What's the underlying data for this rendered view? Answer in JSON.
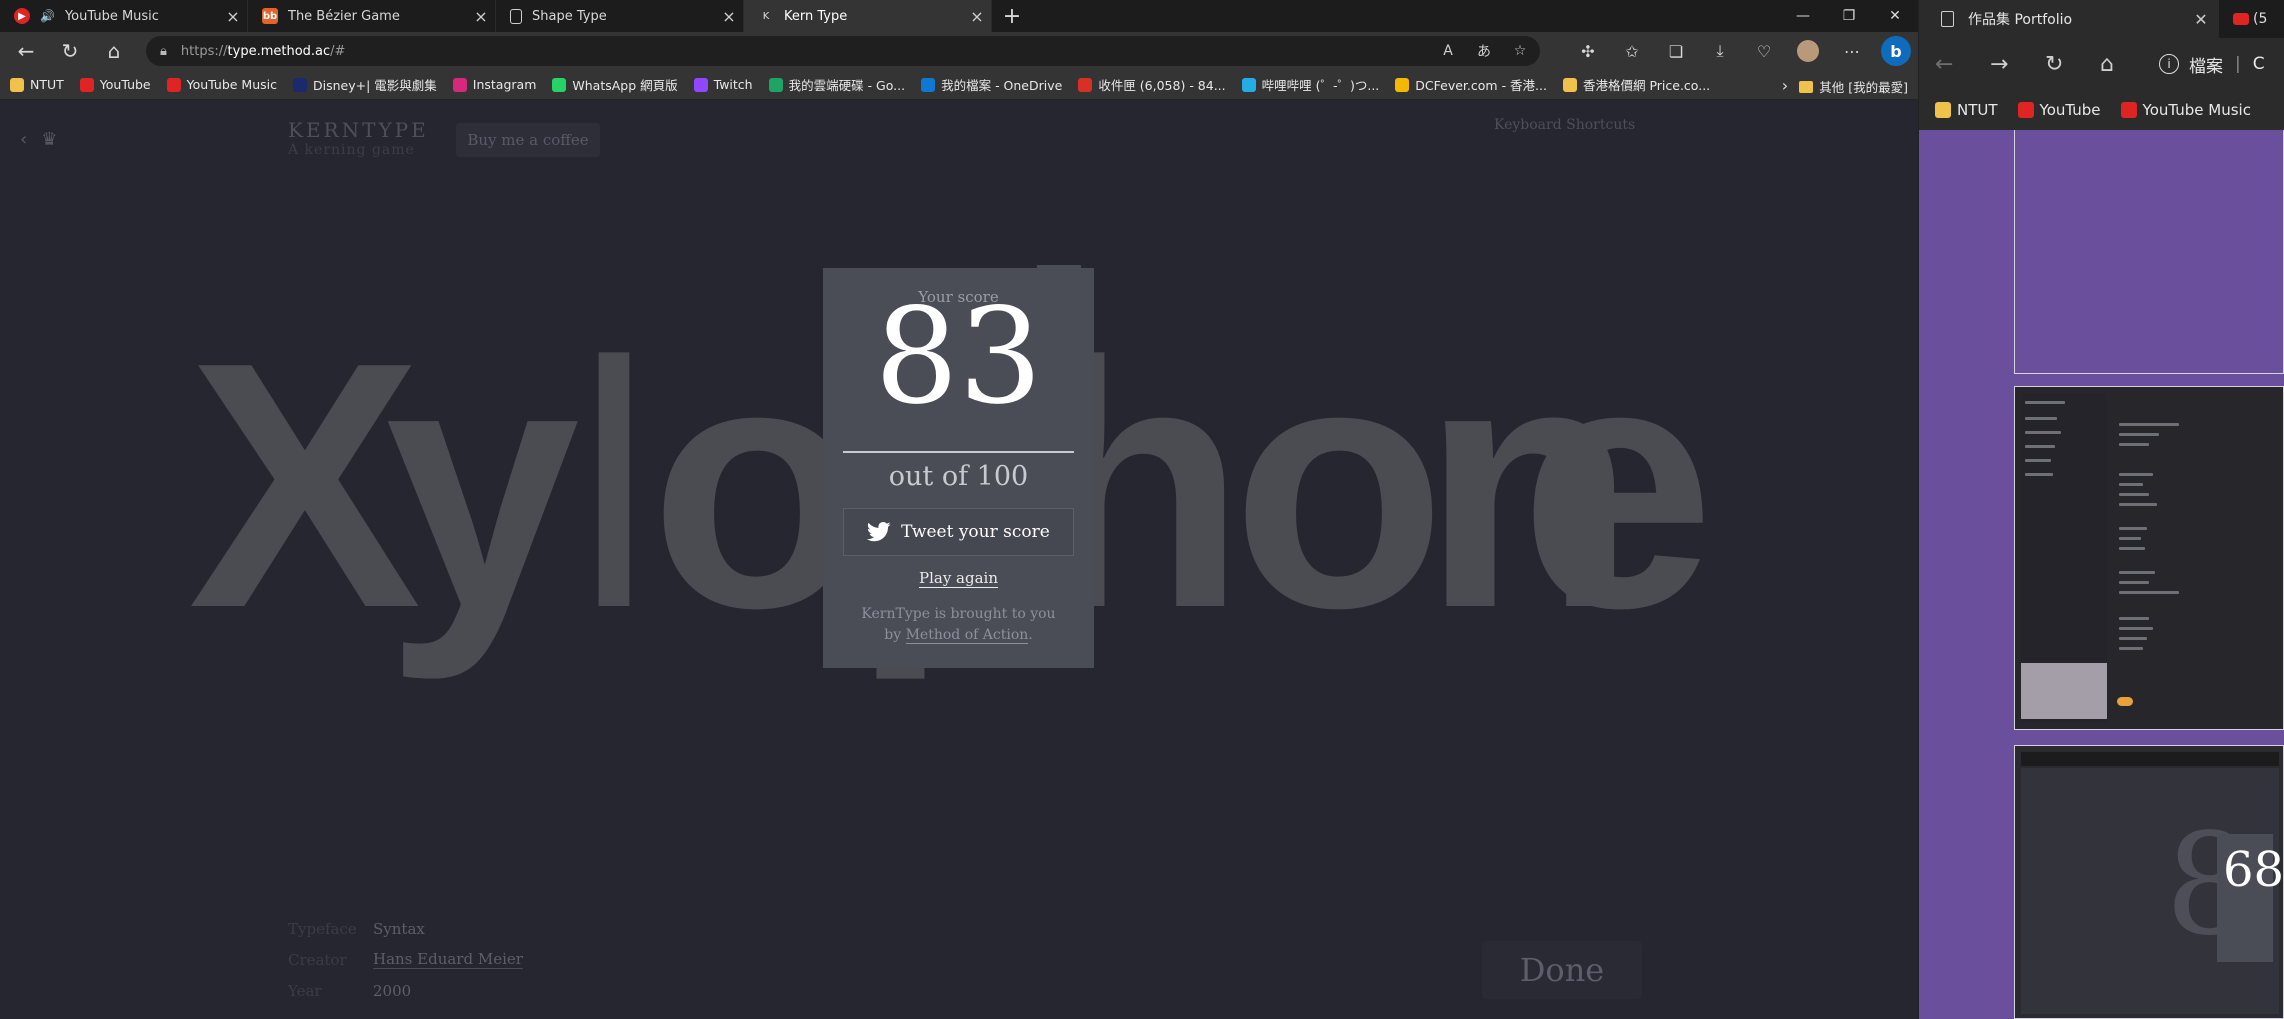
{
  "left_window": {
    "tabs": [
      {
        "title": "YouTube Music",
        "favicon_color": "#e02424",
        "active": false
      },
      {
        "title": "The Bézier Game",
        "favicon_color": "#e5622d",
        "favicon_text": "bb",
        "active": false
      },
      {
        "title": "Shape Type",
        "favicon_color": "",
        "active": false
      },
      {
        "title": "Kern Type",
        "favicon_color": "",
        "favicon_text": "K",
        "active": true
      }
    ],
    "new_tab_label": "+",
    "url_scheme": "https://",
    "url_host": "type.method.ac",
    "url_path": "/#",
    "bookmarks": [
      {
        "label": "NTUT",
        "icon_color": "#f0c24b"
      },
      {
        "label": "YouTube",
        "icon_color": "#e02424"
      },
      {
        "label": "YouTube Music",
        "icon_color": "#e02424"
      },
      {
        "label": "Disney+| 電影與劇集",
        "icon_color": "#1a2a6c"
      },
      {
        "label": "Instagram",
        "icon_color": "#d6297b"
      },
      {
        "label": "WhatsApp 網頁版",
        "icon_color": "#25d366"
      },
      {
        "label": "Twitch",
        "icon_color": "#9146ff"
      },
      {
        "label": "我的雲端硬碟 - Go...",
        "icon_color": "#1fa463"
      },
      {
        "label": "我的檔案 - OneDrive",
        "icon_color": "#0f78d4"
      },
      {
        "label": "收件匣 (6,058) - 84...",
        "icon_color": "#d93025"
      },
      {
        "label": "哔哩哔哩 (゜-゜)つ...",
        "icon_color": "#23ade5"
      },
      {
        "label": "DCFever.com - 香港...",
        "icon_color": "#f5b800"
      },
      {
        "label": "香港格價網 Price.co...",
        "icon_color": "#f0c24b"
      }
    ],
    "other_bookmarks": "其他 [我的最愛]"
  },
  "page": {
    "brand_logo": "KERNTYPE",
    "brand_tagline": "A kerning game",
    "coffee_button": "Buy me a coffee",
    "keyboard_shortcuts": "Keyboard Shortcuts",
    "word_letters": [
      "X",
      "y",
      "l",
      "o",
      "p",
      "h",
      "o",
      "n",
      "e"
    ],
    "meta": {
      "typeface_label": "Typeface",
      "typeface_value": "Syntax",
      "creator_label": "Creator",
      "creator_value": "Hans Eduard Meier",
      "year_label": "Year",
      "year_value": "2000"
    },
    "done_button": "Done"
  },
  "score_modal": {
    "heading": "Your score",
    "score": "83",
    "out_of": "out of 100",
    "tweet_button": "Tweet your score",
    "play_again": "Play again",
    "credit_line1": "KernType is brought to you",
    "credit_line2_prefix": "by ",
    "credit_link": "Method of Action",
    "credit_suffix": "."
  },
  "right_window": {
    "tab_title": "作品集 Portfolio",
    "second_tab_fragment": "(5",
    "address_text": "檔案",
    "address_trailing": "C",
    "bookmarks": [
      {
        "label": "NTUT",
        "icon_color": "#f0c24b"
      },
      {
        "label": "YouTube",
        "icon_color": "#e02424"
      },
      {
        "label": "YouTube Music",
        "icon_color": "#e02424"
      }
    ],
    "thumb3_score": "68",
    "thumb3_bg_digit": "8"
  },
  "colors": {
    "page_bg": "#262630",
    "modal_bg": "#4a4c56",
    "letters": "#4b4b52",
    "right_window_bg": "#6a4f9c"
  }
}
